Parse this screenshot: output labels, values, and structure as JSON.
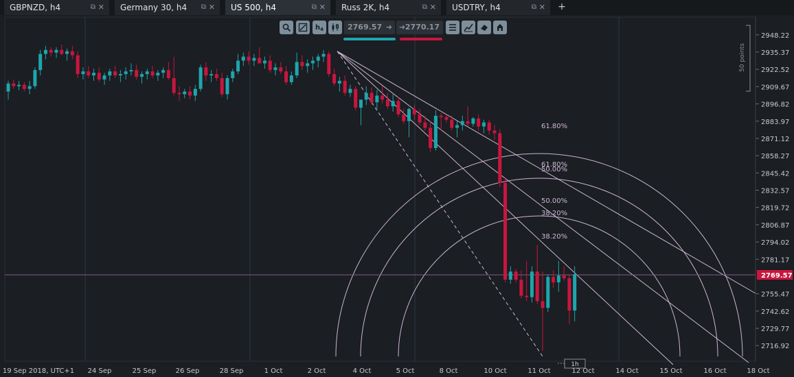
{
  "tabs": [
    {
      "label": "GBPNZD, h4",
      "active": false
    },
    {
      "label": "Germany 30, h4",
      "active": false
    },
    {
      "label": "US 500, h4",
      "active": true
    },
    {
      "label": "Russ 2K, h4",
      "active": false
    },
    {
      "label": "USDTRY, h4",
      "active": false
    }
  ],
  "add_tab_label": "+",
  "toolbar": {
    "timeframe_label": "h",
    "timeframe_sub": "4",
    "bid_price": "2769.57",
    "ask_price": "2770.17"
  },
  "colors": {
    "background": "#1b1e22",
    "bull": "#1fa5ad",
    "bear": "#c8163f",
    "fib": "#cdb6d6",
    "grid": "#2a3a44",
    "price_line": "#7b5d88",
    "price_badge": "#c8163f"
  },
  "chart_data": {
    "type": "candlestick",
    "timeframe": "h4",
    "y_range": [
      2709.0,
      2955.0
    ],
    "y_ticks": [
      2948.22,
      2935.37,
      2922.52,
      2909.67,
      2896.82,
      2883.97,
      2871.12,
      2858.27,
      2845.42,
      2832.57,
      2819.72,
      2806.87,
      2794.02,
      2781.17,
      2755.47,
      2742.62,
      2729.77,
      2716.92
    ],
    "x_tick_labels": [
      "19 Sep 2018, UTC+1",
      "24 Sep",
      "25 Sep",
      "26 Sep",
      "28 Sep",
      "1 Oct",
      "2 Oct",
      "4 Oct",
      "5 Oct",
      "8 Oct",
      "10 Oct",
      "11 Oct",
      "12 Oct",
      "14 Oct",
      "15 Oct",
      "16 Oct",
      "18 Oct"
    ],
    "current_price": "2769.57",
    "scale_label": "50 points",
    "period_label": "1h",
    "fibonacci_labels": [
      "61.80%",
      "61.80%",
      "50.00%",
      "50.00%",
      "38.20%",
      "38.20%"
    ],
    "candles": [
      [
        2906.0,
        2914.0,
        2900.0,
        2912.0
      ],
      [
        2912.0,
        2915.0,
        2908.0,
        2910.0
      ],
      [
        2910.0,
        2914.0,
        2907.0,
        2911.0
      ],
      [
        2911.0,
        2913.0,
        2906.0,
        2908.0
      ],
      [
        2908.0,
        2914.0,
        2904.0,
        2910.0
      ],
      [
        2910.0,
        2924.0,
        2908.0,
        2922.0
      ],
      [
        2922.0,
        2937.0,
        2918.0,
        2934.0
      ],
      [
        2934.0,
        2940.0,
        2930.0,
        2937.0
      ],
      [
        2937.0,
        2939.0,
        2932.0,
        2935.0
      ],
      [
        2935.0,
        2939.0,
        2931.0,
        2937.0
      ],
      [
        2937.0,
        2941.0,
        2933.0,
        2934.0
      ],
      [
        2934.0,
        2938.0,
        2929.0,
        2936.0
      ],
      [
        2936.0,
        2940.0,
        2930.0,
        2933.0
      ],
      [
        2933.0,
        2936.0,
        2916.0,
        2919.0
      ],
      [
        2919.0,
        2924.0,
        2915.0,
        2921.0
      ],
      [
        2921.0,
        2925.0,
        2916.0,
        2918.0
      ],
      [
        2918.0,
        2923.0,
        2914.0,
        2920.0
      ],
      [
        2920.0,
        2924.0,
        2913.0,
        2915.0
      ],
      [
        2915.0,
        2920.0,
        2911.0,
        2918.0
      ],
      [
        2918.0,
        2923.0,
        2914.0,
        2921.0
      ],
      [
        2921.0,
        2925.0,
        2916.0,
        2918.0
      ],
      [
        2918.0,
        2922.0,
        2913.0,
        2919.0
      ],
      [
        2919.0,
        2924.0,
        2915.0,
        2921.0
      ],
      [
        2921.0,
        2927.0,
        2918.0,
        2922.0
      ],
      [
        2922.0,
        2926.0,
        2915.0,
        2917.0
      ],
      [
        2917.0,
        2921.0,
        2912.0,
        2919.0
      ],
      [
        2919.0,
        2923.0,
        2915.0,
        2921.0
      ],
      [
        2921.0,
        2925.0,
        2916.0,
        2918.0
      ],
      [
        2918.0,
        2922.0,
        2914.0,
        2920.0
      ],
      [
        2920.0,
        2924.0,
        2916.0,
        2922.0
      ],
      [
        2922.0,
        2928.0,
        2915.0,
        2916.0
      ],
      [
        2916.0,
        2932.0,
        2903.0,
        2905.0
      ],
      [
        2905.0,
        2910.0,
        2899.0,
        2904.0
      ],
      [
        2904.0,
        2908.0,
        2901.0,
        2906.0
      ],
      [
        2906.0,
        2910.0,
        2900.0,
        2903.0
      ],
      [
        2903.0,
        2911.0,
        2899.0,
        2908.0
      ],
      [
        2908.0,
        2926.0,
        2906.0,
        2924.0
      ],
      [
        2924.0,
        2928.0,
        2914.0,
        2918.0
      ],
      [
        2918.0,
        2922.0,
        2913.0,
        2919.0
      ],
      [
        2919.0,
        2923.0,
        2914.0,
        2916.0
      ],
      [
        2916.0,
        2920.0,
        2902.0,
        2904.0
      ],
      [
        2904.0,
        2918.0,
        2900.0,
        2916.0
      ],
      [
        2916.0,
        2923.0,
        2913.0,
        2921.0
      ],
      [
        2921.0,
        2934.0,
        2919.0,
        2929.0
      ],
      [
        2929.0,
        2935.0,
        2925.0,
        2932.0
      ],
      [
        2932.0,
        2936.0,
        2926.0,
        2929.0
      ],
      [
        2929.0,
        2934.0,
        2925.0,
        2931.0
      ],
      [
        2931.0,
        2939.0,
        2927.0,
        2927.0
      ],
      [
        2927.0,
        2932.0,
        2923.0,
        2929.0
      ],
      [
        2929.0,
        2933.0,
        2920.0,
        2922.0
      ],
      [
        2922.0,
        2927.0,
        2918.0,
        2924.0
      ],
      [
        2924.0,
        2928.0,
        2919.0,
        2921.0
      ],
      [
        2921.0,
        2925.0,
        2911.0,
        2913.0
      ],
      [
        2913.0,
        2921.0,
        2911.0,
        2918.0
      ],
      [
        2918.0,
        2935.0,
        2916.0,
        2928.0
      ],
      [
        2928.0,
        2933.0,
        2922.0,
        2925.0
      ],
      [
        2925.0,
        2930.0,
        2920.0,
        2927.0
      ],
      [
        2927.0,
        2932.0,
        2922.0,
        2929.0
      ],
      [
        2929.0,
        2934.0,
        2924.0,
        2932.0
      ],
      [
        2932.0,
        2937.0,
        2928.0,
        2934.0
      ],
      [
        2934.0,
        2936.0,
        2917.0,
        2919.0
      ],
      [
        2919.0,
        2923.0,
        2910.0,
        2912.0
      ],
      [
        2912.0,
        2917.0,
        2906.0,
        2914.0
      ],
      [
        2914.0,
        2918.0,
        2903.0,
        2905.0
      ],
      [
        2905.0,
        2911.0,
        2902.0,
        2908.0
      ],
      [
        2908.0,
        2910.0,
        2892.0,
        2894.0
      ],
      [
        2894.0,
        2898.0,
        2881.0,
        2900.0
      ],
      [
        2900.0,
        2910.0,
        2896.0,
        2905.0
      ],
      [
        2905.0,
        2909.0,
        2896.0,
        2898.0
      ],
      [
        2898.0,
        2907.0,
        2893.0,
        2903.0
      ],
      [
        2903.0,
        2910.0,
        2897.0,
        2900.0
      ],
      [
        2900.0,
        2905.0,
        2893.0,
        2895.0
      ],
      [
        2895.0,
        2904.0,
        2891.0,
        2899.0
      ],
      [
        2899.0,
        2902.0,
        2887.0,
        2889.0
      ],
      [
        2889.0,
        2893.0,
        2882.0,
        2884.0
      ],
      [
        2884.0,
        2894.0,
        2872.0,
        2893.0
      ],
      [
        2893.0,
        2896.0,
        2885.0,
        2889.0
      ],
      [
        2889.0,
        2893.0,
        2881.0,
        2883.0
      ],
      [
        2883.0,
        2888.0,
        2877.0,
        2879.0
      ],
      [
        2879.0,
        2884.0,
        2861.0,
        2864.0
      ],
      [
        2864.0,
        2892.0,
        2862.0,
        2888.0
      ],
      [
        2888.0,
        2890.0,
        2877.0,
        2887.0
      ],
      [
        2887.0,
        2889.0,
        2883.0,
        2885.0
      ],
      [
        2885.0,
        2888.0,
        2877.0,
        2879.0
      ],
      [
        2879.0,
        2884.0,
        2872.0,
        2881.0
      ],
      [
        2881.0,
        2888.0,
        2877.0,
        2884.0
      ],
      [
        2884.0,
        2895.0,
        2880.0,
        2882.0
      ],
      [
        2882.0,
        2887.0,
        2880.0,
        2886.0
      ],
      [
        2886.0,
        2889.0,
        2877.0,
        2880.0
      ],
      [
        2880.0,
        2885.0,
        2875.0,
        2883.0
      ],
      [
        2883.0,
        2885.0,
        2874.0,
        2877.0
      ],
      [
        2877.0,
        2881.0,
        2870.0,
        2875.0
      ],
      [
        2875.0,
        2878.0,
        2835.0,
        2838.0
      ],
      [
        2838.0,
        2842.0,
        2764.0,
        2766.0
      ],
      [
        2766.0,
        2776.0,
        2763.0,
        2772.0
      ],
      [
        2772.0,
        2774.0,
        2764.0,
        2766.0
      ],
      [
        2766.0,
        2773.0,
        2752.0,
        2754.0
      ],
      [
        2754.0,
        2780.0,
        2750.0,
        2753.0
      ],
      [
        2753.0,
        2776.0,
        2749.0,
        2772.0
      ],
      [
        2772.0,
        2792.0,
        2748.0,
        2750.0
      ],
      [
        2750.0,
        2772.0,
        2713.0,
        2745.0
      ],
      [
        2745.0,
        2770.0,
        2742.0,
        2768.0
      ],
      [
        2768.0,
        2773.0,
        2760.0,
        2764.0
      ],
      [
        2764.0,
        2780.0,
        2757.0,
        2769.0
      ],
      [
        2769.0,
        2776.0,
        2765.0,
        2767.0
      ],
      [
        2767.0,
        2770.0,
        2733.0,
        2743.0
      ],
      [
        2743.0,
        2776.0,
        2735.0,
        2770.0
      ]
    ]
  }
}
